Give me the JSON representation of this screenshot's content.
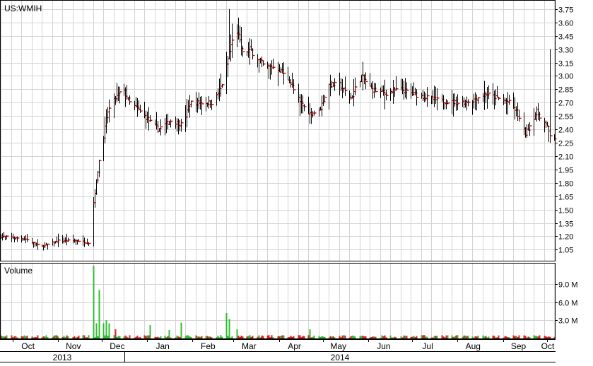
{
  "colors": {
    "background": "#ffffff",
    "grid": "#d4d4d4",
    "frame": "#000000",
    "bar": "#000000",
    "close_tick": "#cc0000",
    "volume_up": "#33bb33",
    "volume_down": "#dd2222"
  },
  "chart_data": [
    {
      "type": "ohlc",
      "title": "US:WMIH",
      "y_axis": {
        "side": "right",
        "ylim": [
          0.95,
          3.82
        ],
        "ticks": [
          "3.75",
          "3.60",
          "3.45",
          "3.30",
          "3.15",
          "3.00",
          "2.85",
          "2.70",
          "2.55",
          "2.40",
          "2.25",
          "2.10",
          "1.95",
          "1.80",
          "1.65",
          "1.50",
          "1.35",
          "1.20",
          "1.05"
        ]
      },
      "grid": true,
      "x": {
        "start": "2013-09-23",
        "end": "2014-10-06",
        "month_labels": [
          "Oct",
          "Nov",
          "Dec",
          "Jan",
          "Feb",
          "Mar",
          "Apr",
          "May",
          "Jun",
          "Jul",
          "Aug",
          "Sep",
          "Oct"
        ],
        "month_dates": [
          "2013-10-01",
          "2013-11-01",
          "2013-12-01",
          "2014-01-01",
          "2014-02-01",
          "2014-03-01",
          "2014-04-01",
          "2014-05-01",
          "2014-06-01",
          "2014-07-01",
          "2014-08-01",
          "2014-09-01",
          "2014-10-01"
        ],
        "year_labels": [
          "2013",
          "2014"
        ]
      },
      "close_anchors": {
        "dates": [
          "2013-09-23",
          "2013-10-10",
          "2013-10-20",
          "2013-11-01",
          "2013-11-15",
          "2013-11-24",
          "2013-11-25",
          "2013-11-29",
          "2013-12-05",
          "2013-12-10",
          "2013-12-15",
          "2013-12-20",
          "2013-12-27",
          "2014-01-05",
          "2014-01-08",
          "2014-01-17",
          "2014-01-25",
          "2014-01-30",
          "2014-02-05",
          "2014-02-15",
          "2014-02-22",
          "2014-02-27",
          "2014-03-03",
          "2014-03-07",
          "2014-03-12",
          "2014-03-22",
          "2014-03-30",
          "2014-04-08",
          "2014-04-15",
          "2014-04-22",
          "2014-04-28",
          "2014-05-05",
          "2014-05-12",
          "2014-05-20",
          "2014-05-27",
          "2014-06-03",
          "2014-06-12",
          "2014-06-22",
          "2014-07-01",
          "2014-07-12",
          "2014-07-20",
          "2014-08-01",
          "2014-08-10",
          "2014-08-20",
          "2014-08-28",
          "2014-09-05",
          "2014-09-10",
          "2014-09-16",
          "2014-09-24",
          "2014-09-30",
          "2014-10-04"
        ],
        "values": [
          1.2,
          1.17,
          1.08,
          1.15,
          1.15,
          1.12,
          1.58,
          2.05,
          2.6,
          2.75,
          2.85,
          2.7,
          2.6,
          2.45,
          2.4,
          2.5,
          2.45,
          2.7,
          2.7,
          2.7,
          2.95,
          3.35,
          3.5,
          3.25,
          3.3,
          3.1,
          3.1,
          2.95,
          2.7,
          2.58,
          2.6,
          2.9,
          2.9,
          2.75,
          3.0,
          2.85,
          2.8,
          2.85,
          2.8,
          2.75,
          2.72,
          2.7,
          2.72,
          2.8,
          2.75,
          2.7,
          2.6,
          2.35,
          2.6,
          2.45,
          2.3
        ]
      },
      "range_spikes": [
        {
          "date": "2014-02-26",
          "high": 3.75
        },
        {
          "date": "2014-03-06",
          "high": 3.55
        },
        {
          "date": "2014-10-03",
          "high": 3.3
        }
      ]
    },
    {
      "type": "bar",
      "title": "Volume",
      "y_axis": {
        "side": "right",
        "ylim": [
          0,
          12000000
        ],
        "ticks": [
          "9.0 M",
          "6.0 M",
          "3.0 M"
        ]
      },
      "spikes": [
        {
          "date": "2013-11-25",
          "value": 12000000
        },
        {
          "date": "2013-11-27",
          "value": 2500000
        },
        {
          "date": "2013-11-29",
          "value": 8000000
        },
        {
          "date": "2013-12-02",
          "value": 2500000
        },
        {
          "date": "2013-12-04",
          "value": 3000000
        },
        {
          "date": "2013-12-06",
          "value": 2500000
        },
        {
          "date": "2013-12-10",
          "value": 1500000
        },
        {
          "date": "2014-01-03",
          "value": 2200000
        },
        {
          "date": "2014-01-16",
          "value": 1400000
        },
        {
          "date": "2014-01-24",
          "value": 2600000
        },
        {
          "date": "2014-02-24",
          "value": 4200000
        },
        {
          "date": "2014-02-26",
          "value": 3200000
        },
        {
          "date": "2014-03-03",
          "value": 1500000
        },
        {
          "date": "2014-04-22",
          "value": 1500000
        }
      ],
      "baseline": 350000
    }
  ]
}
